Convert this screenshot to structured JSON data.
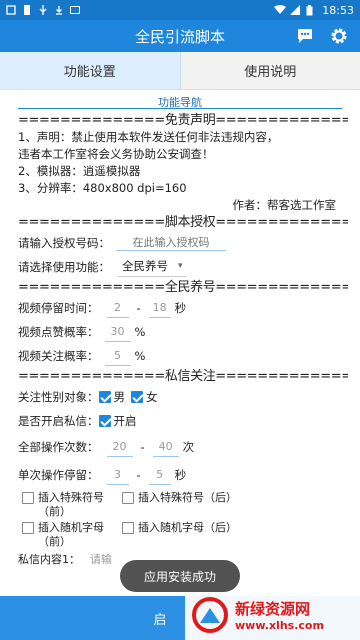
{
  "status_bar": {
    "time": "18:53"
  },
  "app_bar": {
    "title": "全民引流脚本"
  },
  "tabs": [
    {
      "label": "功能设置"
    },
    {
      "label": "使用说明"
    }
  ],
  "nav_label": "功能导航",
  "disclaimer": {
    "header": "==============免责声明=============",
    "line1": "1、声明：禁止使用本软件发送任何非法违规内容，",
    "line2": "违者本工作室将会义务协助公安调查！",
    "line3": "2、模拟器：逍遥模拟器",
    "line4": "3、分辨率：480x800 dpi=160",
    "author": "作者：帮客选工作室"
  },
  "auth": {
    "header": "==============脚本授权=============",
    "code_label": "请输入授权号码：",
    "code_placeholder": "在此输入授权码",
    "func_label": "请选择使用功能：",
    "func_value": "全民养号",
    "func_arrow": "▾"
  },
  "raise": {
    "header": "==============全民养号==============",
    "stay_label": "视频停留时间：",
    "stay_min": "2",
    "stay_sep": "-",
    "stay_max": "18",
    "stay_unit": "秒",
    "like_label": "视频点赞概率：",
    "like_value": "30",
    "like_unit": "%",
    "follow_label": "视频关注概率：",
    "follow_value": "5",
    "follow_unit": "%"
  },
  "dm": {
    "header": "==============私信关注=============",
    "gender_label": "关注性别对象：",
    "male": "男",
    "female": "女",
    "enable_label": "是否开启私信：",
    "enable_text": "开启",
    "total_label": "全部操作次数：",
    "total_min": "20",
    "total_sep": "-",
    "total_max": "40",
    "total_unit": "次",
    "single_label": "单次操作停留：",
    "single_min": "3",
    "single_sep": "-",
    "single_max": "5",
    "single_unit": "秒",
    "opt1": "插入特殊符号（前）",
    "opt2": "插入特殊符号（后）",
    "opt3": "插入随机字母（前）",
    "opt4": "插入随机字母（后）",
    "content_label": "私信内容1：",
    "content_placeholder": "请输"
  },
  "toast": "应用安装成功",
  "bottom": {
    "start_label": "启"
  },
  "watermark": {
    "name": "新绿资源网",
    "url": "www.xlhs.com"
  },
  "colors": {
    "primary": "#1f86dd",
    "statusbar": "#1778c9",
    "tab_active": "#dceefe",
    "watermark_red": "#e21919"
  }
}
